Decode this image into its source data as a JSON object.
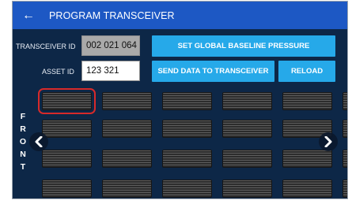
{
  "header": {
    "title": "PROGRAM TRANSCEIVER",
    "back_icon": "arrow-left-icon"
  },
  "form": {
    "transceiver_id": {
      "label": "TRANSCEIVER ID",
      "value": "002 021 064"
    },
    "asset_id": {
      "label": "ASSET ID",
      "value": "123 321"
    }
  },
  "buttons": {
    "set_baseline": "SET GLOBAL BASELINE PRESSURE",
    "send_data": "SEND DATA TO TRANSCEIVER",
    "reload": "RELOAD"
  },
  "grid": {
    "side_label": "FRONT",
    "rows": 4,
    "columns": 5,
    "selected": {
      "row": 1,
      "column": 1
    },
    "nav_icons": [
      "chevron-left-icon",
      "chevron-right-icon"
    ]
  },
  "colors": {
    "background": "#0d2747",
    "titlebar": "#1d58c4",
    "button": "#26a9e9",
    "selection": "#d72a2a"
  }
}
